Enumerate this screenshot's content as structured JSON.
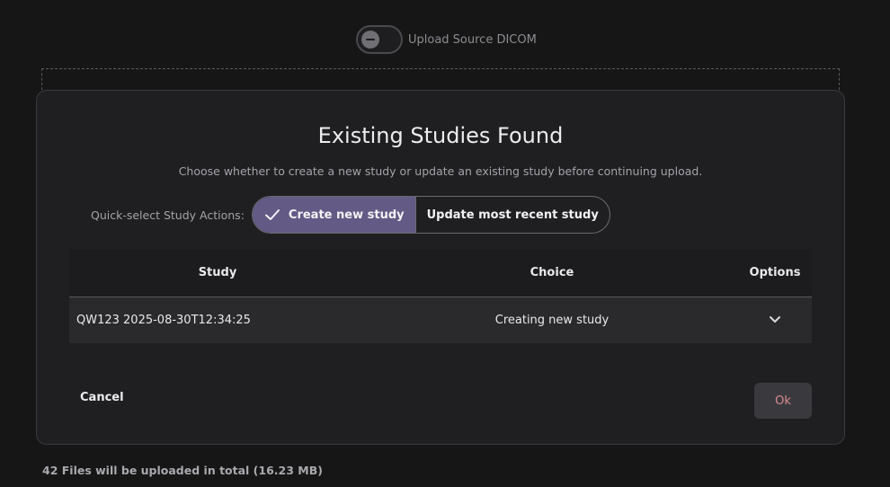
{
  "top_toggle": {
    "label": "Upload Source DICOM",
    "on": false
  },
  "modal": {
    "title": "Existing Studies Found",
    "subtitle": "Choose whether to create a new study or update an existing study before continuing upload.",
    "quick_select": {
      "label": "Quick-select Study Actions:",
      "options": [
        {
          "label": "Create new study",
          "selected": true
        },
        {
          "label": "Update most recent study",
          "selected": false
        }
      ]
    },
    "table": {
      "headers": {
        "study": "Study",
        "choice": "Choice",
        "options": "Options"
      },
      "rows": [
        {
          "study": "QW123 2025-08-30T12:34:25",
          "choice": "Creating new study"
        }
      ]
    },
    "cancel_label": "Cancel",
    "ok_label": "Ok"
  },
  "footer_note": "42 Files will be uploaded in total (16.23 MB)",
  "colors": {
    "accent": "#635a85",
    "ok_text": "#d98a90",
    "background": "#161617",
    "modal": "#1f1f22"
  }
}
